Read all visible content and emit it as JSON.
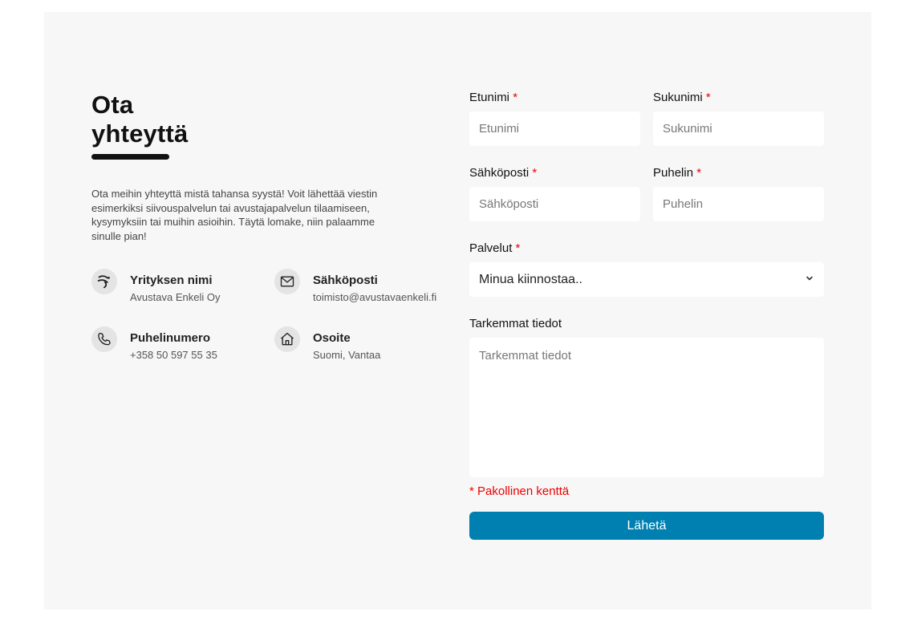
{
  "heading": {
    "title_line1": "Ota",
    "title_line2": "yhteyttä",
    "intro": "Ota meihin yhteyttä mistä tahansa syystä! Voit lähettää viestin esimerkiksi siivouspalvelun tai avustajapalvelun tilaamiseen, kysymyksiin tai muihin asioihin. Täytä lomake, niin palaamme sinulle pian!"
  },
  "info": {
    "company": {
      "label": "Yrityksen nimi",
      "value": "Avustava Enkeli Oy",
      "icon": "angel-logo-icon"
    },
    "email": {
      "label": "Sähköposti",
      "value": "toimisto@avustavaenkeli.fi",
      "icon": "envelope-icon"
    },
    "phone": {
      "label": "Puhelinumero",
      "value": "+358 50 597 55 35",
      "icon": "phone-icon"
    },
    "address": {
      "label": "Osoite",
      "value": "Suomi, Vantaa",
      "icon": "home-icon"
    }
  },
  "form": {
    "required_mark": "*",
    "firstname": {
      "label": "Etunimi",
      "placeholder": "Etunimi"
    },
    "lastname": {
      "label": "Sukunimi",
      "placeholder": "Sukunimi"
    },
    "email": {
      "label": "Sähköposti",
      "placeholder": "Sähköposti"
    },
    "phone": {
      "label": "Puhelin",
      "placeholder": "Puhelin"
    },
    "services": {
      "label": "Palvelut",
      "selected": "Minua kiinnostaa.."
    },
    "details": {
      "label": "Tarkemmat tiedot",
      "placeholder": "Tarkemmat tiedot"
    },
    "required_note": "* Pakollinen kenttä",
    "submit_label": "Lähetä"
  },
  "colors": {
    "panel_bg": "#f7f7f7",
    "accent": "#0080b0",
    "required": "#e00000"
  }
}
